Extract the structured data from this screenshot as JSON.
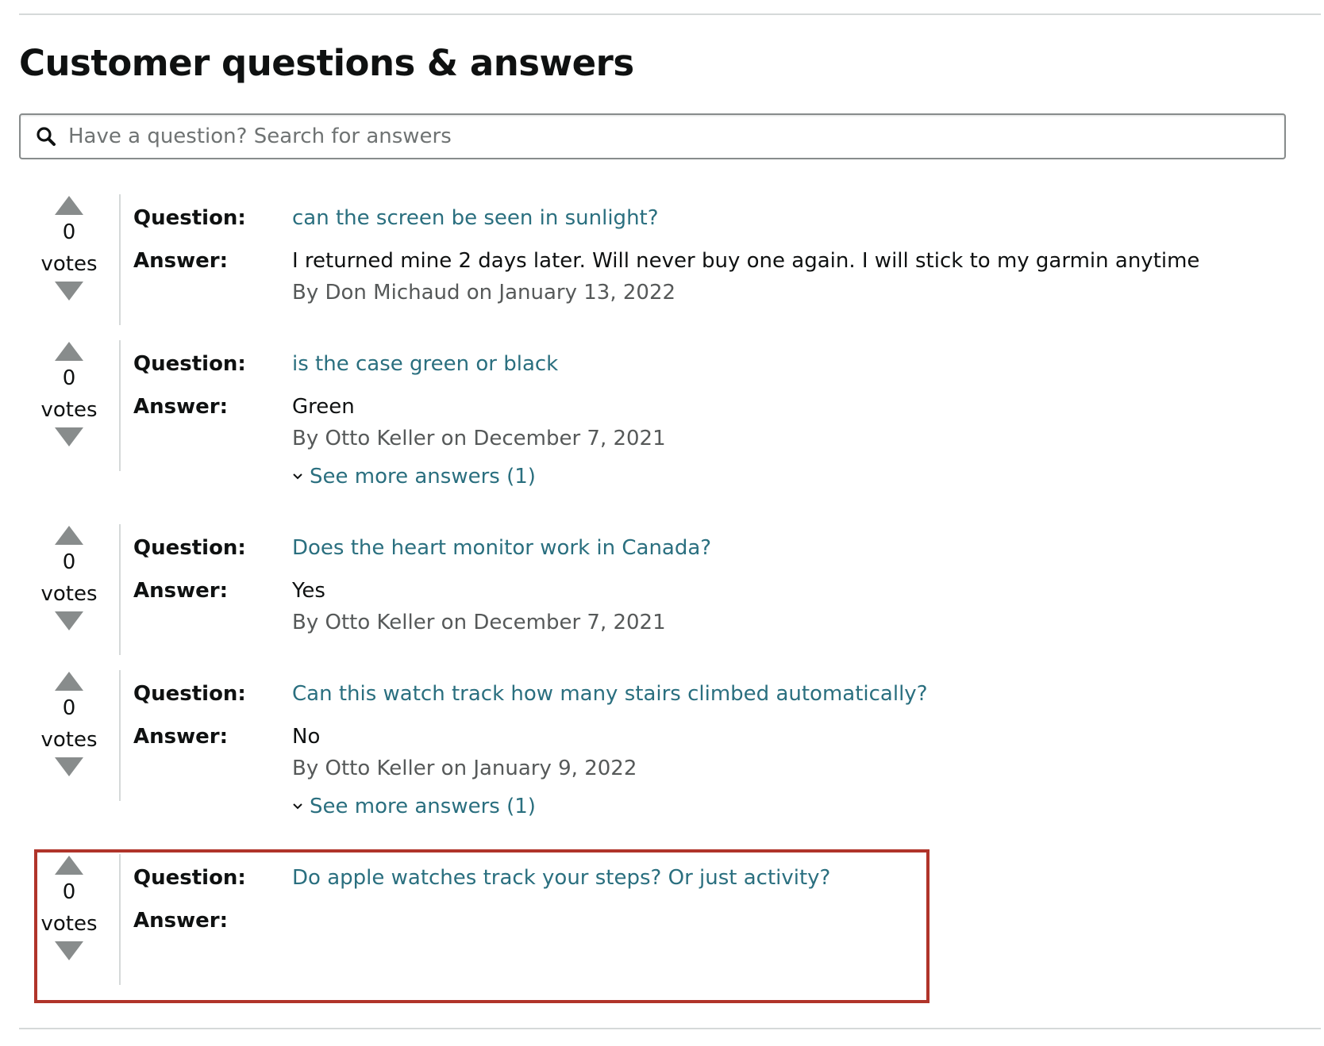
{
  "page": {
    "title": "Customer questions & answers"
  },
  "search": {
    "placeholder": "Have a question? Search for answers",
    "icon": "search-icon"
  },
  "labels": {
    "question": "Question:",
    "answer": "Answer:",
    "votes": "votes"
  },
  "qa_items": [
    {
      "votes": "0",
      "question": "can the screen be seen in sunlight?",
      "answer": "I returned mine 2 days later. Will never buy one again. I will stick to my garmin anytime",
      "byline": "By Don Michaud on January 13, 2022",
      "see_more": ""
    },
    {
      "votes": "0",
      "question": "is the case green or black",
      "answer": "Green",
      "byline": "By Otto Keller on December 7, 2021",
      "see_more": "See more answers (1)"
    },
    {
      "votes": "0",
      "question": "Does the heart monitor work in Canada?",
      "answer": "Yes",
      "byline": "By Otto Keller on December 7, 2021",
      "see_more": ""
    },
    {
      "votes": "0",
      "question": "Can this watch track how many stairs climbed automatically?",
      "answer": "No",
      "byline": "By Otto Keller on January 9, 2022",
      "see_more": "See more answers (1)"
    },
    {
      "votes": "0",
      "question": "Do apple watches track your steps? Or just activity?",
      "answer": "",
      "byline": "",
      "see_more": ""
    }
  ],
  "colors": {
    "link": "#2a6f7f",
    "byline": "#565959",
    "vote_arrow": "#888c8c",
    "highlight_border": "#b0342a"
  }
}
